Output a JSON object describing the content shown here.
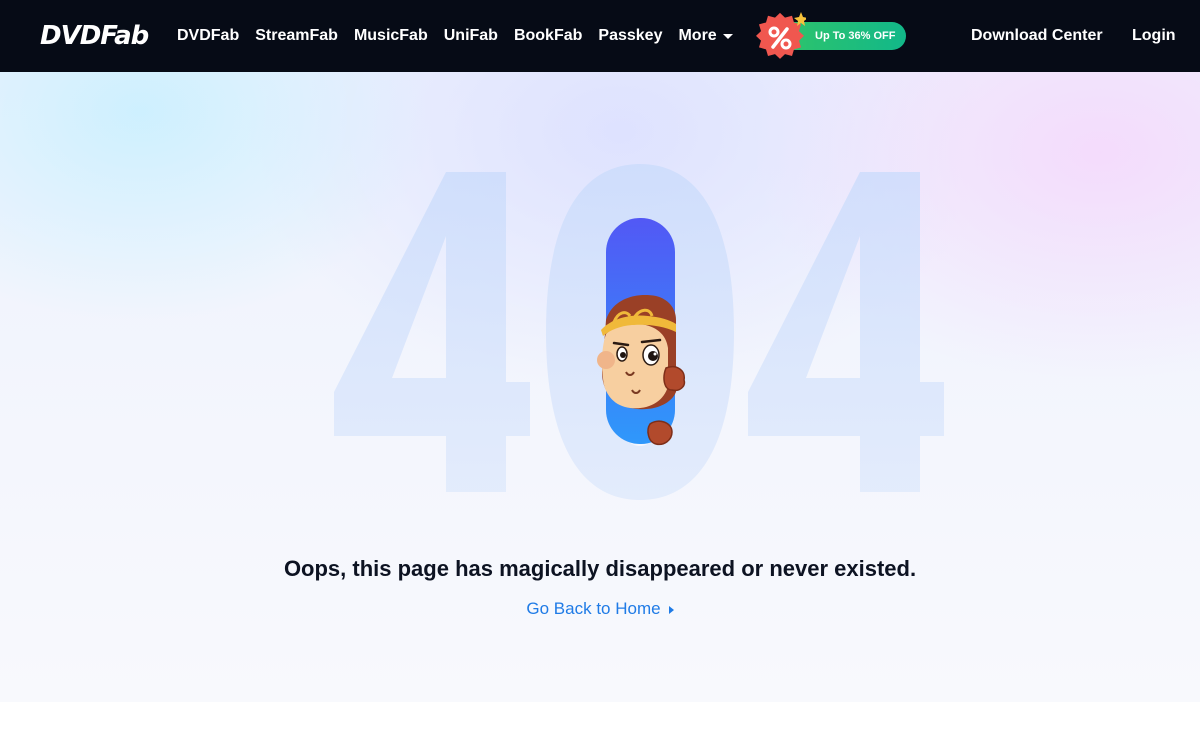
{
  "header": {
    "logo_text": "DVDFab",
    "nav": [
      {
        "label": "DVDFab"
      },
      {
        "label": "StreamFab"
      },
      {
        "label": "MusicFab"
      },
      {
        "label": "UniFab"
      },
      {
        "label": "BookFab"
      },
      {
        "label": "Passkey"
      },
      {
        "label": "More"
      }
    ],
    "promo": {
      "text": "Up To 36% OFF",
      "icon": "percent-badge-icon",
      "accent": "#2fc46a"
    },
    "download_center": "Download Center",
    "login": "Login",
    "background": "#060b16"
  },
  "hero": {
    "error_code": "404",
    "digits": [
      "4",
      "0",
      "4"
    ],
    "message": "Oops, this page has magically disappeared or never existed.",
    "home_link": "Go Back to Home",
    "link_color": "#1f7be6",
    "illustration": "monkey-mascot-peeking"
  }
}
